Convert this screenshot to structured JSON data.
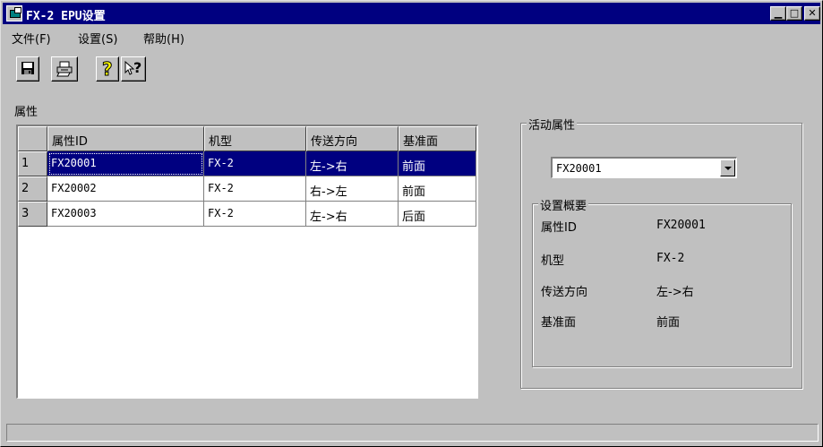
{
  "window": {
    "title": "FX-2 EPU设置",
    "controls": {
      "minimize": "▁",
      "maximize": "□",
      "close": "✕"
    }
  },
  "menu": [
    {
      "label": "文件(F)"
    },
    {
      "label": "设置(S)"
    },
    {
      "label": "帮助(H)"
    }
  ],
  "toolbar": {
    "icons": [
      "save-icon",
      "print-icon",
      "help-icon",
      "context-help-icon"
    ],
    "help_glyph": "?",
    "context_help_glyph": "?"
  },
  "properties": {
    "label": "属性",
    "columns": [
      "属性ID",
      "机型",
      "传送方向",
      "基准面"
    ],
    "rows": [
      {
        "num": "1",
        "id": "FX20001",
        "model": "FX-2",
        "direction": "左->右",
        "reference": "前面",
        "selected": true
      },
      {
        "num": "2",
        "id": "FX20002",
        "model": "FX-2",
        "direction": "右->左",
        "reference": "前面"
      },
      {
        "num": "3",
        "id": "FX20003",
        "model": "FX-2",
        "direction": "左->右",
        "reference": "后面"
      }
    ]
  },
  "active": {
    "label": "活动属性",
    "selected": "FX20001",
    "summary": {
      "label": "设置概要",
      "items": [
        {
          "label": "属性ID",
          "value": "FX20001"
        },
        {
          "label": "机型",
          "value": "FX-2"
        },
        {
          "label": "传送方向",
          "value": "左->右"
        },
        {
          "label": "基准面",
          "value": "前面"
        }
      ]
    }
  },
  "status": {
    "text": ""
  },
  "colors": {
    "face": "#c0c0c0",
    "titlebar": "#000080",
    "selection": "#000080"
  }
}
